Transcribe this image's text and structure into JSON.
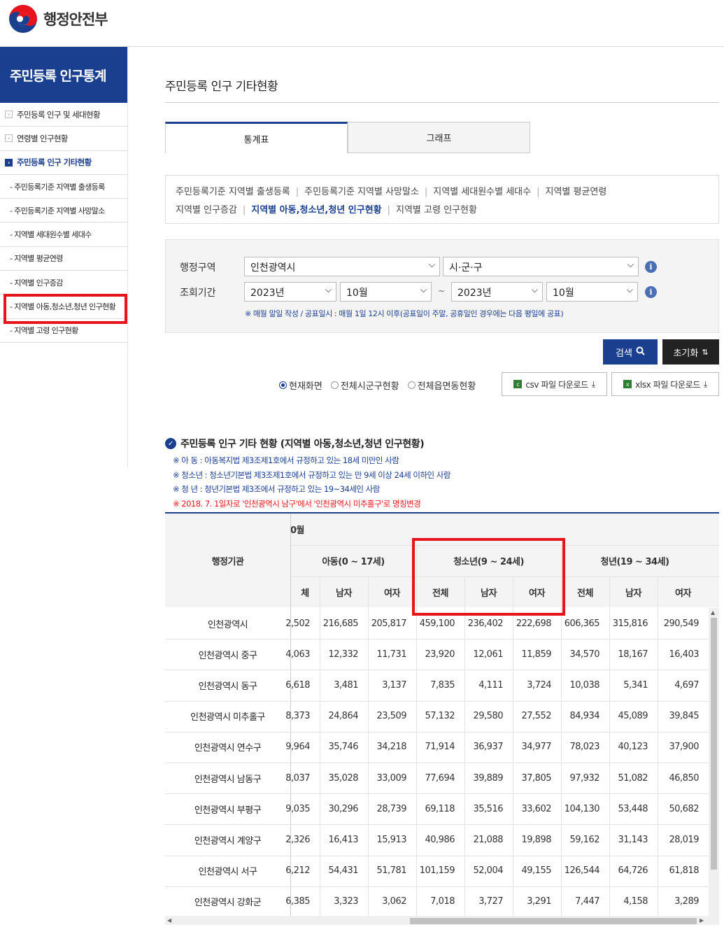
{
  "header": {
    "logo_text": "행정안전부"
  },
  "sidebar": {
    "title": "주민등록 인구통계",
    "items": [
      {
        "label": "주민등록 인구 및 세대현황",
        "type": "main"
      },
      {
        "label": "연령별 인구현황",
        "type": "main"
      },
      {
        "label": "주민등록 인구 기타현황",
        "type": "active"
      },
      {
        "label": "- 주민등록기준 지역별 출생등록",
        "type": "sub"
      },
      {
        "label": "- 주민등록기준 지역별 사망말소",
        "type": "sub"
      },
      {
        "label": "- 지역별 세대원수별 세대수",
        "type": "sub"
      },
      {
        "label": "- 지역별 평균연령",
        "type": "sub"
      },
      {
        "label": "- 지역별 인구증감",
        "type": "sub"
      },
      {
        "label": "- 지역별 아동,청소년,청년 인구현황",
        "type": "sub-hl"
      },
      {
        "label": "- 지역별 고령 인구현황",
        "type": "sub"
      }
    ]
  },
  "main": {
    "page_title": "주민등록 인구 기타현황",
    "tabs": [
      "통계표",
      "그래프"
    ],
    "subnav": [
      "주민등록기준 지역별 출생등록",
      "주민등록기준 지역별 사망말소",
      "지역별 세대원수별 세대수",
      "지역별 평균연령",
      "지역별 인구증감",
      "지역별 아동,청소년,청년 인구현황",
      "지역별 고령 인구현황"
    ],
    "filter": {
      "region_label": "행정구역",
      "period_label": "조회기간",
      "sido": "인천광역시",
      "sigungu": "시·군·구",
      "start_year": "2023년",
      "start_month": "10월",
      "tilde": "~",
      "end_year": "2023년",
      "end_month": "10월",
      "note": "※ 매월 말일 작성 / 공표일시 : 매월 1일 12시 이후(공표일이 주말, 공휴일인 경우에는 다음 평일에 공표)"
    },
    "buttons": {
      "search": "검색",
      "reset": "초기화",
      "csv": "csv 파일 다운로드",
      "xlsx": "xlsx 파일 다운로드"
    },
    "radios": [
      "현재화면",
      "전체시군구현황",
      "전체읍면동현황"
    ],
    "section_title": "주민등록 인구 기타 현황 (지역별 아동,청소년,청년 인구현황)",
    "notes": [
      "※ 아 동 : 아동복지법 제3조제1호에서 규정하고 있는 18세 미만인 사람",
      "※ 청소년 : 청소년기본법 제3조제1호에서 규정하고 있는 만 9세 이상 24세 이하인 사람",
      "※ 청 년 : 청년기본법 제3조에서 규정하고 있는 19~34세인 사람"
    ],
    "red_note": "※ 2018. 7. 1일자로 '인천광역시 남구'에서 '인천광역시 미추홀구'로 명칭변경",
    "table": {
      "org_header": "행정기관",
      "month_header": "0월",
      "groups": [
        "아동(0 ~ 17세)",
        "청소년(9 ~ 24세)",
        "청년(19 ~ 34세)"
      ],
      "sub_headers": [
        "체",
        "남자",
        "여자",
        "전체",
        "남자",
        "여자",
        "전체",
        "남자",
        "여자"
      ],
      "rows": [
        {
          "name": "인천광역시",
          "vals": [
            "2,502",
            "216,685",
            "205,817",
            "459,100",
            "236,402",
            "222,698",
            "606,365",
            "315,816",
            "290,549"
          ]
        },
        {
          "name": "인천광역시 중구",
          "vals": [
            "4,063",
            "12,332",
            "11,731",
            "23,920",
            "12,061",
            "11,859",
            "34,570",
            "18,167",
            "16,403"
          ]
        },
        {
          "name": "인천광역시 동구",
          "vals": [
            "6,618",
            "3,481",
            "3,137",
            "7,835",
            "4,111",
            "3,724",
            "10,038",
            "5,341",
            "4,697"
          ]
        },
        {
          "name": "인천광역시 미추홀구",
          "vals": [
            "8,373",
            "24,864",
            "23,509",
            "57,132",
            "29,580",
            "27,552",
            "84,934",
            "45,089",
            "39,845"
          ]
        },
        {
          "name": "인천광역시 연수구",
          "vals": [
            "9,964",
            "35,746",
            "34,218",
            "71,914",
            "36,937",
            "34,977",
            "78,023",
            "40,123",
            "37,900"
          ]
        },
        {
          "name": "인천광역시 남동구",
          "vals": [
            "8,037",
            "35,028",
            "33,009",
            "77,694",
            "39,889",
            "37,805",
            "97,932",
            "51,082",
            "46,850"
          ]
        },
        {
          "name": "인천광역시 부평구",
          "vals": [
            "9,035",
            "30,296",
            "28,739",
            "69,118",
            "35,516",
            "33,602",
            "104,130",
            "53,448",
            "50,682"
          ]
        },
        {
          "name": "인천광역시 계양구",
          "vals": [
            "2,326",
            "16,413",
            "15,913",
            "40,986",
            "21,088",
            "19,898",
            "59,162",
            "31,143",
            "28,019"
          ]
        },
        {
          "name": "인천광역시 서구",
          "vals": [
            "6,212",
            "54,431",
            "51,781",
            "101,159",
            "52,004",
            "49,155",
            "126,544",
            "64,726",
            "61,818"
          ]
        },
        {
          "name": "인천광역시 강화군",
          "vals": [
            "6,385",
            "3,323",
            "3,062",
            "7,018",
            "3,727",
            "3,291",
            "7,447",
            "4,158",
            "3,289"
          ]
        }
      ]
    }
  },
  "colors": {
    "brand": "#1b3f8f",
    "highlight": "#e8141b"
  }
}
